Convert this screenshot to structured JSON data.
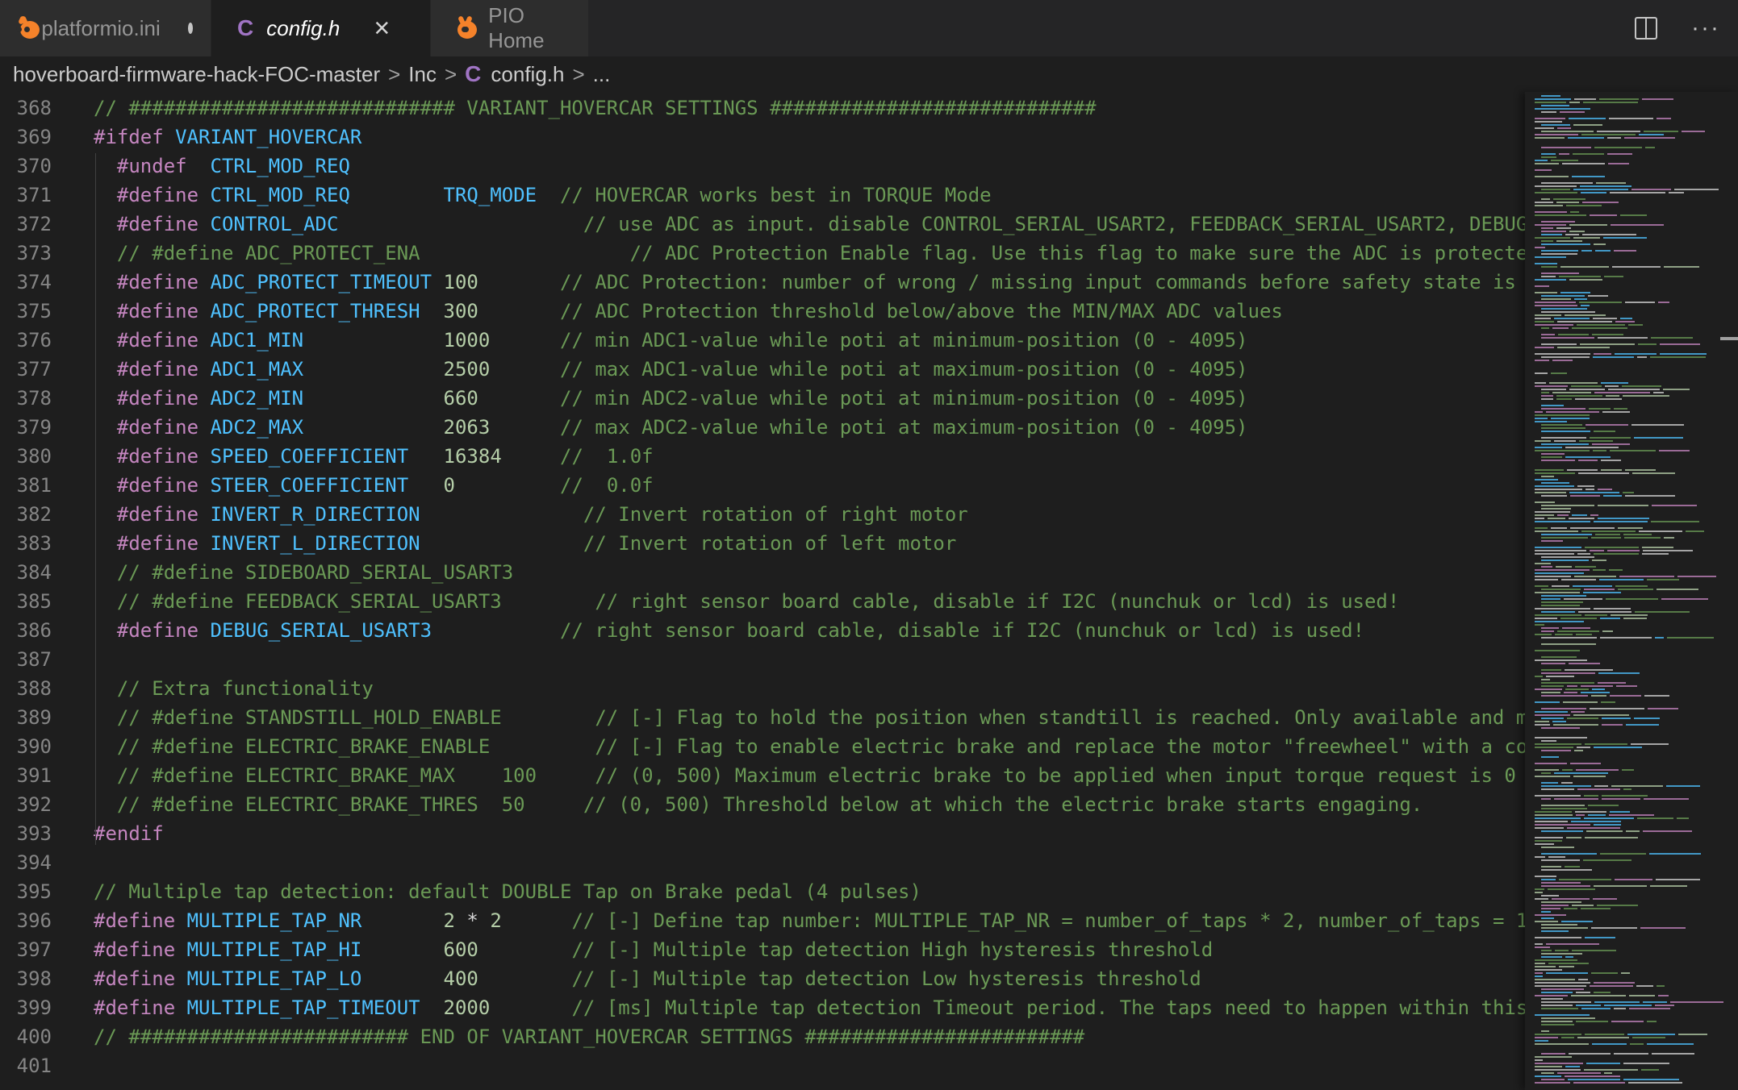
{
  "tabs": [
    {
      "label": "platformio.ini",
      "icon": "platformio-icon",
      "modified": true
    },
    {
      "label": "config.h",
      "icon": "c-file-icon",
      "active": true
    },
    {
      "label": "PIO Home",
      "icon": "platformio-icon"
    }
  ],
  "tab_actions": {
    "close": "×",
    "more": "···"
  },
  "breadcrumb": {
    "parts": [
      "hoverboard-firmware-hack-FOC-master",
      "Inc",
      "config.h",
      "..."
    ],
    "c_glyph": "C",
    "sep": ">"
  },
  "editor": {
    "lines": [
      {
        "n": "368",
        "t": [
          [
            "cm",
            "// ############################ VARIANT_HOVERCAR SETTINGS ############################"
          ]
        ]
      },
      {
        "n": "369",
        "t": [
          [
            "kw",
            "#ifdef"
          ],
          [
            "plain",
            " "
          ],
          [
            "mac",
            "VARIANT_HOVERCAR"
          ]
        ]
      },
      {
        "n": "370",
        "t": [
          [
            "plain",
            "  "
          ],
          [
            "kw",
            "#undef"
          ],
          [
            "plain",
            "  "
          ],
          [
            "mac",
            "CTRL_MOD_REQ"
          ]
        ]
      },
      {
        "n": "371",
        "t": [
          [
            "plain",
            "  "
          ],
          [
            "kw",
            "#define"
          ],
          [
            "plain",
            " "
          ],
          [
            "mac",
            "CTRL_MOD_REQ"
          ],
          [
            "plain",
            "        "
          ],
          [
            "id",
            "TRQ_MODE"
          ],
          [
            "plain",
            "  "
          ],
          [
            "cm",
            "// HOVERCAR works best in TORQUE Mode"
          ]
        ]
      },
      {
        "n": "372",
        "t": [
          [
            "plain",
            "  "
          ],
          [
            "kw",
            "#define"
          ],
          [
            "plain",
            " "
          ],
          [
            "mac",
            "CONTROL_ADC"
          ],
          [
            "plain",
            "                     "
          ],
          [
            "cm",
            "// use ADC as input. disable CONTROL_SERIAL_USART2, FEEDBACK_SERIAL_USART2, DEBUG_S"
          ]
        ]
      },
      {
        "n": "373",
        "t": [
          [
            "plain",
            "  "
          ],
          [
            "cm",
            "// #define ADC_PROTECT_ENA                  // ADC Protection Enable flag. Use this flag to make sure the ADC is protected w"
          ]
        ]
      },
      {
        "n": "374",
        "t": [
          [
            "plain",
            "  "
          ],
          [
            "kw",
            "#define"
          ],
          [
            "plain",
            " "
          ],
          [
            "mac",
            "ADC_PROTECT_TIMEOUT"
          ],
          [
            "plain",
            " "
          ],
          [
            "num",
            "100"
          ],
          [
            "plain",
            "       "
          ],
          [
            "cm",
            "// ADC Protection: number of wrong / missing input commands before safety state is"
          ]
        ]
      },
      {
        "n": "375",
        "t": [
          [
            "plain",
            "  "
          ],
          [
            "kw",
            "#define"
          ],
          [
            "plain",
            " "
          ],
          [
            "mac",
            "ADC_PROTECT_THRESH"
          ],
          [
            "plain",
            "  "
          ],
          [
            "num",
            "300"
          ],
          [
            "plain",
            "       "
          ],
          [
            "cm",
            "// ADC Protection threshold below/above the MIN/MAX ADC values"
          ]
        ]
      },
      {
        "n": "376",
        "t": [
          [
            "plain",
            "  "
          ],
          [
            "kw",
            "#define"
          ],
          [
            "plain",
            " "
          ],
          [
            "mac",
            "ADC1_MIN"
          ],
          [
            "plain",
            "            "
          ],
          [
            "num",
            "1000"
          ],
          [
            "plain",
            "      "
          ],
          [
            "cm",
            "// min ADC1-value while poti at minimum-position (0 - 4095)"
          ]
        ]
      },
      {
        "n": "377",
        "t": [
          [
            "plain",
            "  "
          ],
          [
            "kw",
            "#define"
          ],
          [
            "plain",
            " "
          ],
          [
            "mac",
            "ADC1_MAX"
          ],
          [
            "plain",
            "            "
          ],
          [
            "num",
            "2500"
          ],
          [
            "plain",
            "      "
          ],
          [
            "cm",
            "// max ADC1-value while poti at maximum-position (0 - 4095)"
          ]
        ]
      },
      {
        "n": "378",
        "t": [
          [
            "plain",
            "  "
          ],
          [
            "kw",
            "#define"
          ],
          [
            "plain",
            " "
          ],
          [
            "mac",
            "ADC2_MIN"
          ],
          [
            "plain",
            "            "
          ],
          [
            "num",
            "660"
          ],
          [
            "plain",
            "       "
          ],
          [
            "cm",
            "// min ADC2-value while poti at minimum-position (0 - 4095)"
          ]
        ]
      },
      {
        "n": "379",
        "t": [
          [
            "plain",
            "  "
          ],
          [
            "kw",
            "#define"
          ],
          [
            "plain",
            " "
          ],
          [
            "mac",
            "ADC2_MAX"
          ],
          [
            "plain",
            "            "
          ],
          [
            "num",
            "2063"
          ],
          [
            "plain",
            "      "
          ],
          [
            "cm",
            "// max ADC2-value while poti at maximum-position (0 - 4095)"
          ]
        ]
      },
      {
        "n": "380",
        "t": [
          [
            "plain",
            "  "
          ],
          [
            "kw",
            "#define"
          ],
          [
            "plain",
            " "
          ],
          [
            "mac",
            "SPEED_COEFFICIENT"
          ],
          [
            "plain",
            "   "
          ],
          [
            "num",
            "16384"
          ],
          [
            "plain",
            "     "
          ],
          [
            "cm",
            "//  1.0f"
          ]
        ]
      },
      {
        "n": "381",
        "t": [
          [
            "plain",
            "  "
          ],
          [
            "kw",
            "#define"
          ],
          [
            "plain",
            " "
          ],
          [
            "mac",
            "STEER_COEFFICIENT"
          ],
          [
            "plain",
            "   "
          ],
          [
            "num",
            "0"
          ],
          [
            "plain",
            "         "
          ],
          [
            "cm",
            "//  0.0f"
          ]
        ]
      },
      {
        "n": "382",
        "t": [
          [
            "plain",
            "  "
          ],
          [
            "kw",
            "#define"
          ],
          [
            "plain",
            " "
          ],
          [
            "mac",
            "INVERT_R_DIRECTION"
          ],
          [
            "plain",
            "              "
          ],
          [
            "cm",
            "// Invert rotation of right motor"
          ]
        ]
      },
      {
        "n": "383",
        "t": [
          [
            "plain",
            "  "
          ],
          [
            "kw",
            "#define"
          ],
          [
            "plain",
            " "
          ],
          [
            "mac",
            "INVERT_L_DIRECTION"
          ],
          [
            "plain",
            "              "
          ],
          [
            "cm",
            "// Invert rotation of left motor"
          ]
        ]
      },
      {
        "n": "384",
        "t": [
          [
            "plain",
            "  "
          ],
          [
            "cm",
            "// #define SIDEBOARD_SERIAL_USART3"
          ]
        ]
      },
      {
        "n": "385",
        "t": [
          [
            "plain",
            "  "
          ],
          [
            "cm",
            "// #define FEEDBACK_SERIAL_USART3        // right sensor board cable, disable if I2C (nunchuk or lcd) is used!"
          ]
        ]
      },
      {
        "n": "386",
        "t": [
          [
            "plain",
            "  "
          ],
          [
            "kw",
            "#define"
          ],
          [
            "plain",
            " "
          ],
          [
            "mac",
            "DEBUG_SERIAL_USART3"
          ],
          [
            "plain",
            "           "
          ],
          [
            "cm",
            "// right sensor board cable, disable if I2C (nunchuk or lcd) is used!"
          ]
        ]
      },
      {
        "n": "387",
        "t": []
      },
      {
        "n": "388",
        "t": [
          [
            "plain",
            "  "
          ],
          [
            "cm",
            "// Extra functionality"
          ]
        ]
      },
      {
        "n": "389",
        "t": [
          [
            "plain",
            "  "
          ],
          [
            "cm",
            "// #define STANDSTILL_HOLD_ENABLE        // [-] Flag to hold the position when standtill is reached. Only available and m"
          ]
        ]
      },
      {
        "n": "390",
        "t": [
          [
            "plain",
            "  "
          ],
          [
            "cm",
            "// #define ELECTRIC_BRAKE_ENABLE         // [-] Flag to enable electric brake and replace the motor \"freewheel\" with a co"
          ]
        ]
      },
      {
        "n": "391",
        "t": [
          [
            "plain",
            "  "
          ],
          [
            "cm",
            "// #define ELECTRIC_BRAKE_MAX    100     // (0, 500) Maximum electric brake to be applied when input torque request is 0"
          ]
        ]
      },
      {
        "n": "392",
        "t": [
          [
            "plain",
            "  "
          ],
          [
            "cm",
            "// #define ELECTRIC_BRAKE_THRES  50     // (0, 500) Threshold below at which the electric brake starts engaging."
          ]
        ]
      },
      {
        "n": "393",
        "t": [
          [
            "kw",
            "#endif"
          ]
        ]
      },
      {
        "n": "394",
        "t": []
      },
      {
        "n": "395",
        "t": [
          [
            "cm",
            "// Multiple tap detection: default DOUBLE Tap on Brake pedal (4 pulses)"
          ]
        ]
      },
      {
        "n": "396",
        "t": [
          [
            "kw",
            "#define"
          ],
          [
            "plain",
            " "
          ],
          [
            "mac",
            "MULTIPLE_TAP_NR"
          ],
          [
            "plain",
            "       "
          ],
          [
            "num",
            "2"
          ],
          [
            "plain",
            " * "
          ],
          [
            "num",
            "2"
          ],
          [
            "plain",
            "      "
          ],
          [
            "cm",
            "// [-] Define tap number: MULTIPLE_TAP_NR = number_of_taps * 2, number_of_taps = 1"
          ]
        ]
      },
      {
        "n": "397",
        "t": [
          [
            "kw",
            "#define"
          ],
          [
            "plain",
            " "
          ],
          [
            "mac",
            "MULTIPLE_TAP_HI"
          ],
          [
            "plain",
            "       "
          ],
          [
            "num",
            "600"
          ],
          [
            "plain",
            "        "
          ],
          [
            "cm",
            "// [-] Multiple tap detection High hysteresis threshold"
          ]
        ]
      },
      {
        "n": "398",
        "t": [
          [
            "kw",
            "#define"
          ],
          [
            "plain",
            " "
          ],
          [
            "mac",
            "MULTIPLE_TAP_LO"
          ],
          [
            "plain",
            "       "
          ],
          [
            "num",
            "400"
          ],
          [
            "plain",
            "        "
          ],
          [
            "cm",
            "// [-] Multiple tap detection Low hysteresis threshold"
          ]
        ]
      },
      {
        "n": "399",
        "t": [
          [
            "kw",
            "#define"
          ],
          [
            "plain",
            " "
          ],
          [
            "mac",
            "MULTIPLE_TAP_TIMEOUT"
          ],
          [
            "plain",
            "  "
          ],
          [
            "num",
            "2000"
          ],
          [
            "plain",
            "       "
          ],
          [
            "cm",
            "// [ms] Multiple tap detection Timeout period. The taps need to happen within this"
          ]
        ]
      },
      {
        "n": "400",
        "t": [
          [
            "cm",
            "// ######################## END OF VARIANT_HOVERCAR SETTINGS ########################"
          ]
        ]
      },
      {
        "n": "401",
        "t": []
      }
    ]
  },
  "colors": {
    "keyword": "#c586c0",
    "macro": "#4fc1ff",
    "number": "#b5cea8",
    "comment": "#6a9955",
    "text": "#d4d4d4",
    "line_number": "#858585",
    "background": "#1e1e1e"
  }
}
